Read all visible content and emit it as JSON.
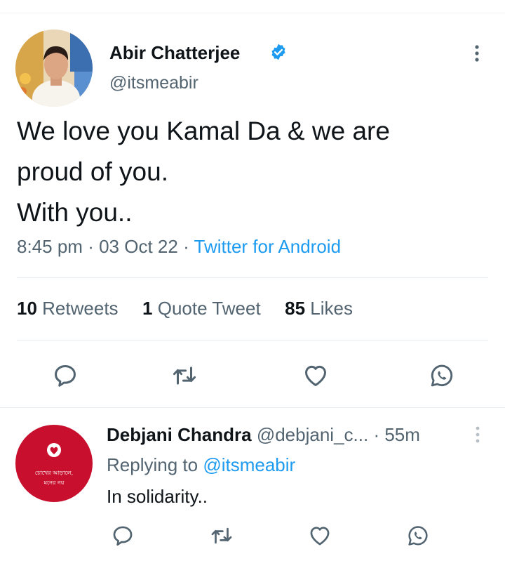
{
  "tweet": {
    "author_name": "Abir Chatterjee",
    "handle": "@itsmeabir",
    "text_lines": [
      "We love you Kamal Da & we are",
      "proud of you.",
      "With you.."
    ],
    "time": "8:45 pm",
    "date": "03 Oct 22",
    "separator": "·",
    "source": "Twitter for Android",
    "stats": {
      "retweets_count": "10",
      "retweets_label": "Retweets",
      "quotes_count": "1",
      "quotes_label": "Quote Tweet",
      "likes_count": "85",
      "likes_label": "Likes"
    }
  },
  "reply": {
    "author_name": "Debjani Chandra",
    "handle": "@debjani_c...",
    "time_ago": "· 55m",
    "replying_prefix": "Replying to",
    "replying_handle": "@itsmeabir",
    "text": "In solidarity..",
    "avatar_text_line1": "চোখের আড়ালে,",
    "avatar_text_line2": "মনের নয়"
  },
  "colors": {
    "link": "#1d9bf0",
    "muted": "#536471",
    "verified": "#1d9bf0",
    "reply_avatar_bg": "#c8102e"
  },
  "icons": [
    "verified-badge-icon",
    "more-options-icon",
    "reply-icon",
    "retweet-icon",
    "like-icon",
    "whatsapp-share-icon"
  ]
}
